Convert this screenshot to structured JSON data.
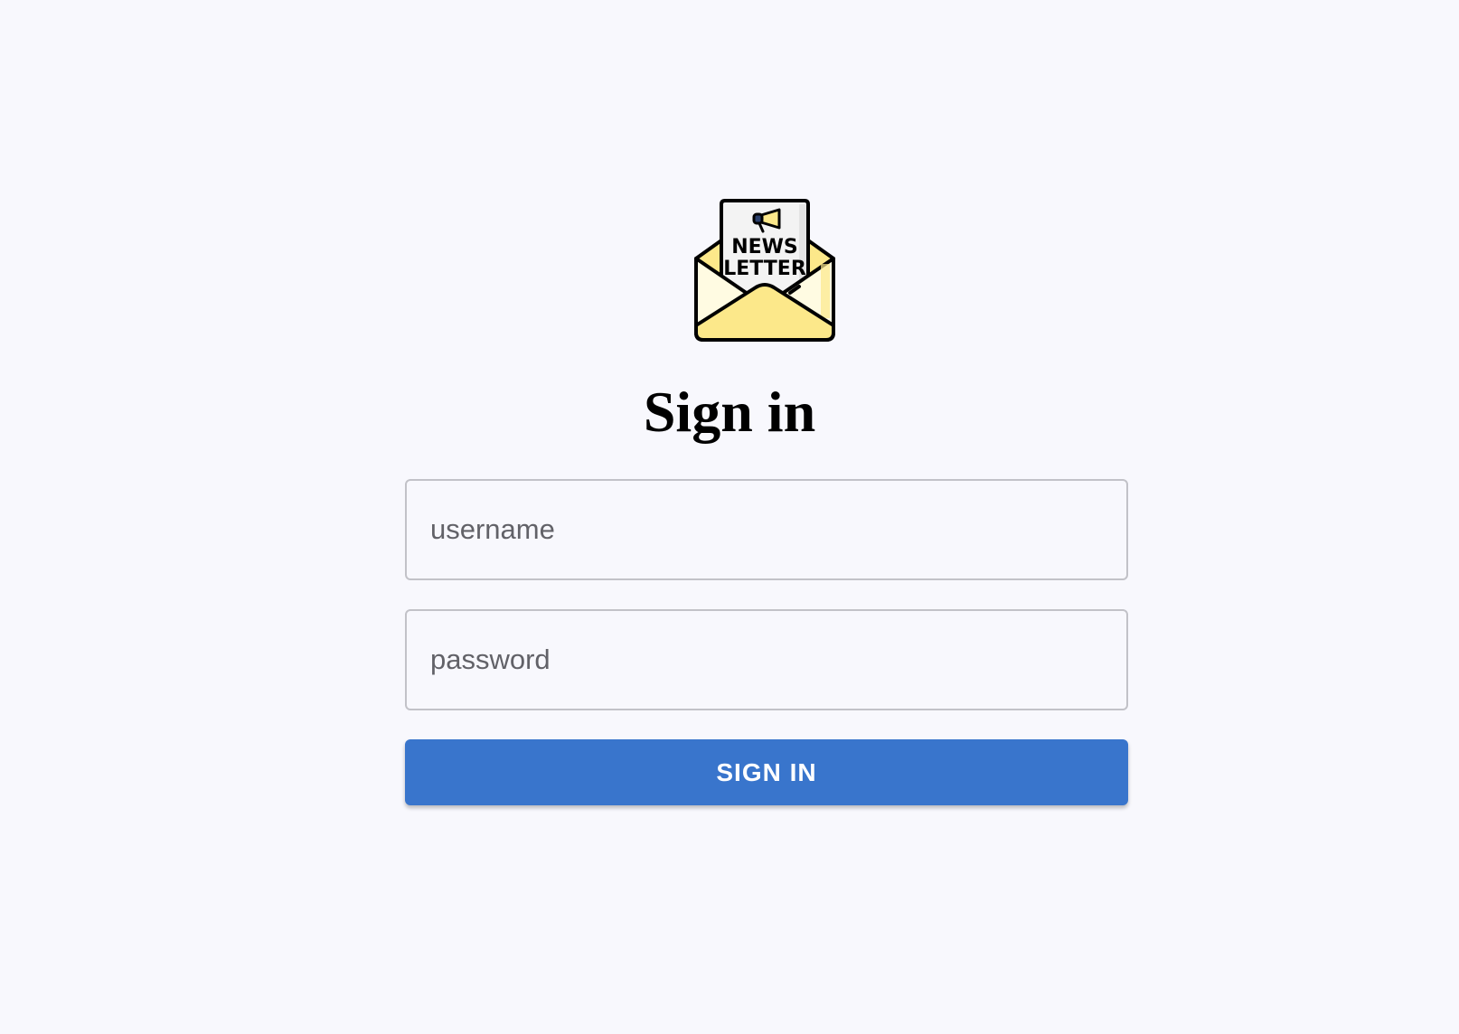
{
  "logo": {
    "icon": "newsletter-envelope-icon",
    "line1": "NEWS",
    "line2": "LETTER",
    "colors": {
      "envelope": "#fce88a",
      "envelope_light": "#fffbe2",
      "paper": "#f3f3f3",
      "outline": "#000000"
    }
  },
  "title": "Sign in",
  "form": {
    "username_placeholder": "username",
    "password_placeholder": "password",
    "submit_label": "SIGN IN"
  },
  "colors": {
    "background": "#f8f8fd",
    "primary": "#3975cc",
    "field_border": "#c2c2c8",
    "placeholder": "#626268"
  }
}
